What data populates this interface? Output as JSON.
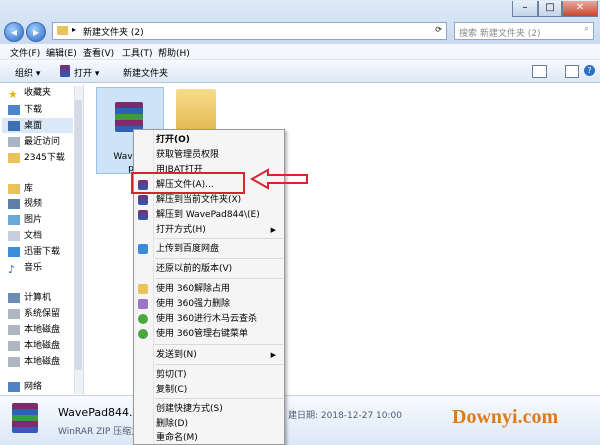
{
  "address": {
    "path": "新建文件夹 (2)",
    "search_placeholder": "搜索 新建文件夹 (2)"
  },
  "menubar": [
    "文件(F)",
    "编辑(E)",
    "查看(V)",
    "工具(T)",
    "帮助(H)"
  ],
  "toolbar": {
    "organize": "组织 ▾",
    "open": "打开 ▾",
    "new_folder": "新建文件夹"
  },
  "nav": {
    "favorites": "收藏夹",
    "fav_items": [
      "下载",
      "桌面",
      "最近访问",
      "2345下载"
    ],
    "library": "库",
    "lib_items": [
      "视频",
      "图片",
      "文档",
      "迅雷下载",
      "音乐"
    ],
    "computer": "计算机",
    "comp_items": [
      "系统保留",
      "本地磁盘",
      "本地磁盘",
      "本地磁盘"
    ],
    "network": "网络"
  },
  "file": {
    "name": "WavePad844.zip",
    "label_line1": "WavePa",
    "label_line2": "p"
  },
  "context_menu": {
    "g1": [
      "打开(O)",
      "获取管理员权限",
      "用IBAT打开",
      "解压文件(A)...",
      "解压到当前文件夹(X)",
      "解压到 WavePad844\\(E)",
      "打开方式(H)"
    ],
    "g2": [
      "上传到百度网盘"
    ],
    "g3": [
      "还原以前的版本(V)"
    ],
    "g4": [
      "使用 360解除占用",
      "使用 360强力删除",
      "使用 360进行木马云查杀",
      "使用 360管理右键菜单"
    ],
    "g5": [
      "发送到(N)"
    ],
    "g6": [
      "剪切(T)",
      "复制(C)"
    ],
    "g7": [
      "创建快捷方式(S)",
      "删除(D)",
      "重命名(M)"
    ]
  },
  "details": {
    "name": "WavePad844.zip",
    "type": "WinRAR ZIP 压缩文",
    "date": "建日期: 2018-12-27 10:00"
  },
  "watermark": "Downyi.com",
  "colors": {
    "highlight_box": "#d9232e",
    "selection": "#cde3f8",
    "watermark": "#e07a1a"
  }
}
